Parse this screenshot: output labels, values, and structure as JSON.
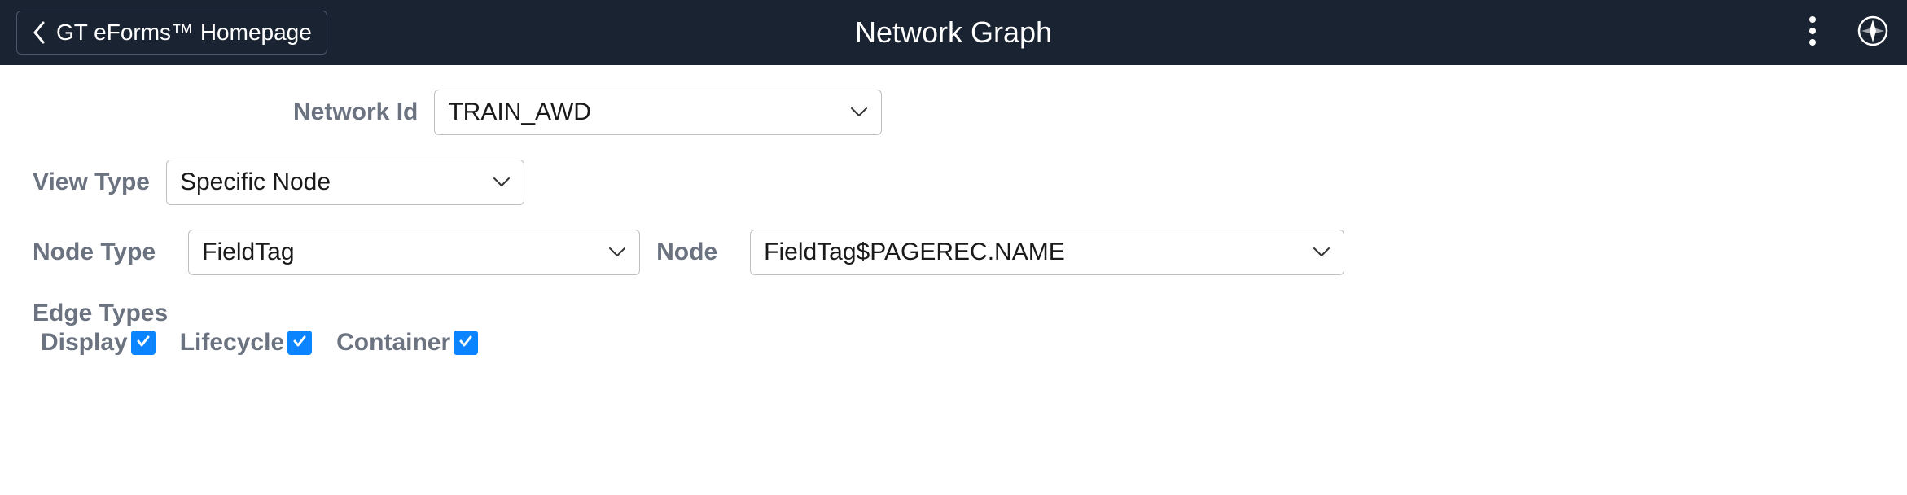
{
  "header": {
    "back_label": "GT eForms™ Homepage",
    "title": "Network Graph"
  },
  "form": {
    "network_id": {
      "label": "Network Id",
      "value": "TRAIN_AWD"
    },
    "view_type": {
      "label": "View Type",
      "value": "Specific Node"
    },
    "node_type": {
      "label": "Node Type",
      "value": "FieldTag"
    },
    "node": {
      "label": "Node",
      "value": "FieldTag$PAGEREC.NAME"
    },
    "edge_types": {
      "title": "Edge Types",
      "display": {
        "label": "Display",
        "checked": true
      },
      "lifecycle": {
        "label": "Lifecycle",
        "checked": true
      },
      "container": {
        "label": "Container",
        "checked": true
      }
    }
  }
}
